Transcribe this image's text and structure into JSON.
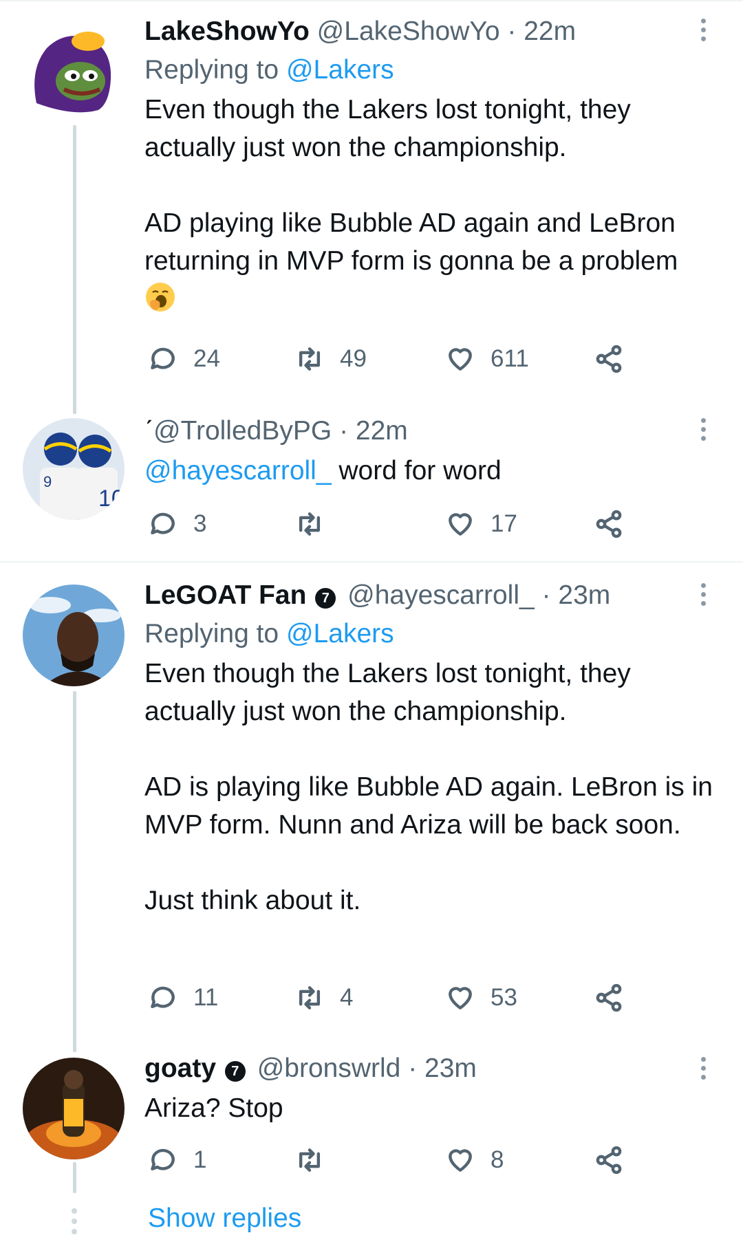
{
  "tweets": [
    {
      "name": "LakeShowYo",
      "handle": "@LakeShowYo",
      "time": "22m",
      "replying_label": "Replying to",
      "replying_to": "@Lakers",
      "body": [
        "Even though the Lakers lost tonight, they actually just won the championship.",
        "AD playing like Bubble AD again and LeBron returning in MVP form is gonna be a problem"
      ],
      "emoji": "yawning-face",
      "replies": "24",
      "retweets": "49",
      "likes": "611"
    },
    {
      "name_prefix": "ˊ",
      "handle": "@TrolledByPG",
      "time": "22m",
      "mention": "@hayescarroll_",
      "body_rest": " word for word",
      "replies": "3",
      "retweets": "",
      "likes": "17"
    },
    {
      "name": "LeGOAT Fan",
      "badge": "7",
      "handle": "@hayescarroll_",
      "time": "23m",
      "replying_label": "Replying to",
      "replying_to": "@Lakers",
      "body": [
        "Even though the Lakers lost tonight, they actually just won the championship.",
        "AD is playing like Bubble AD again. LeBron is in MVP form. Nunn and Ariza will be back soon.",
        "Just think about it."
      ],
      "replies": "11",
      "retweets": "4",
      "likes": "53"
    },
    {
      "name": "goaty",
      "badge": "7",
      "handle": "@bronswrld",
      "time": "23m",
      "body": [
        "Ariza? Stop"
      ],
      "replies": "1",
      "retweets": "",
      "likes": "8"
    }
  ],
  "separator": "·",
  "show_replies": "Show replies",
  "colors": {
    "link": "#1d9bf0",
    "muted": "#536471",
    "text": "#0f1419",
    "divider": "#eff3f4",
    "thread": "#cfd9de"
  }
}
